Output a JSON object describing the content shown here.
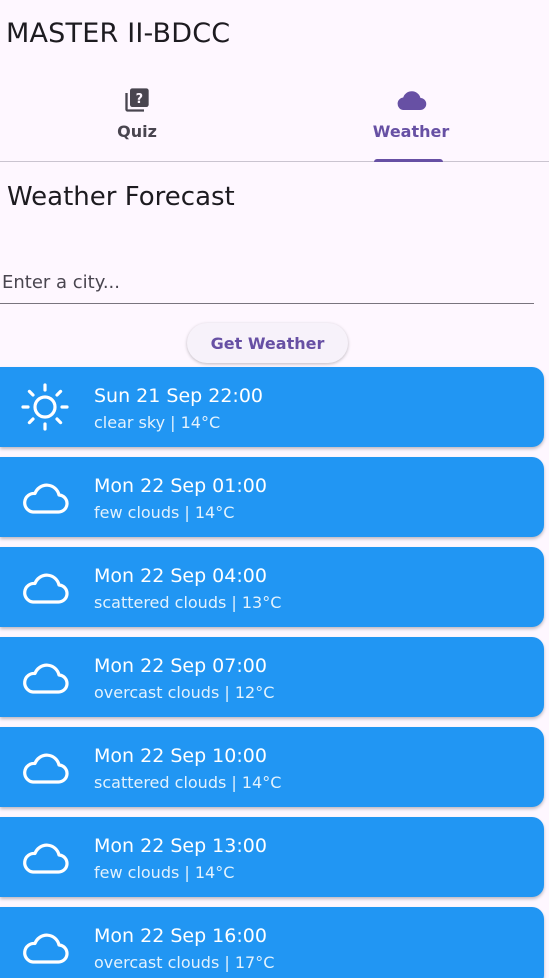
{
  "appbar": {
    "title": "MASTER II-BDCC"
  },
  "tabs": [
    {
      "label": "Quiz",
      "icon": "quiz-icon",
      "selected": false
    },
    {
      "label": "Weather",
      "icon": "cloud-icon",
      "selected": true
    }
  ],
  "colors": {
    "accent": "#6750A4",
    "card": "#2196F3",
    "background": "#FEF7FF"
  },
  "weather": {
    "title": "Weather Forecast",
    "city_input": {
      "value": "",
      "placeholder": "Enter a city..."
    },
    "button_label": "Get Weather",
    "forecasts": [
      {
        "time": "Sun 21 Sep 22:00",
        "summary": "clear sky | 14°C",
        "icon": "sun-icon"
      },
      {
        "time": "Mon 22 Sep 01:00",
        "summary": "few clouds | 14°C",
        "icon": "cloud-icon"
      },
      {
        "time": "Mon 22 Sep 04:00",
        "summary": "scattered clouds | 13°C",
        "icon": "cloud-icon"
      },
      {
        "time": "Mon 22 Sep 07:00",
        "summary": "overcast clouds | 12°C",
        "icon": "cloud-icon"
      },
      {
        "time": "Mon 22 Sep 10:00",
        "summary": "scattered clouds | 14°C",
        "icon": "cloud-icon"
      },
      {
        "time": "Mon 22 Sep 13:00",
        "summary": "few clouds | 14°C",
        "icon": "cloud-icon"
      },
      {
        "time": "Mon 22 Sep 16:00",
        "summary": "overcast clouds | 17°C",
        "icon": "cloud-icon"
      }
    ]
  }
}
